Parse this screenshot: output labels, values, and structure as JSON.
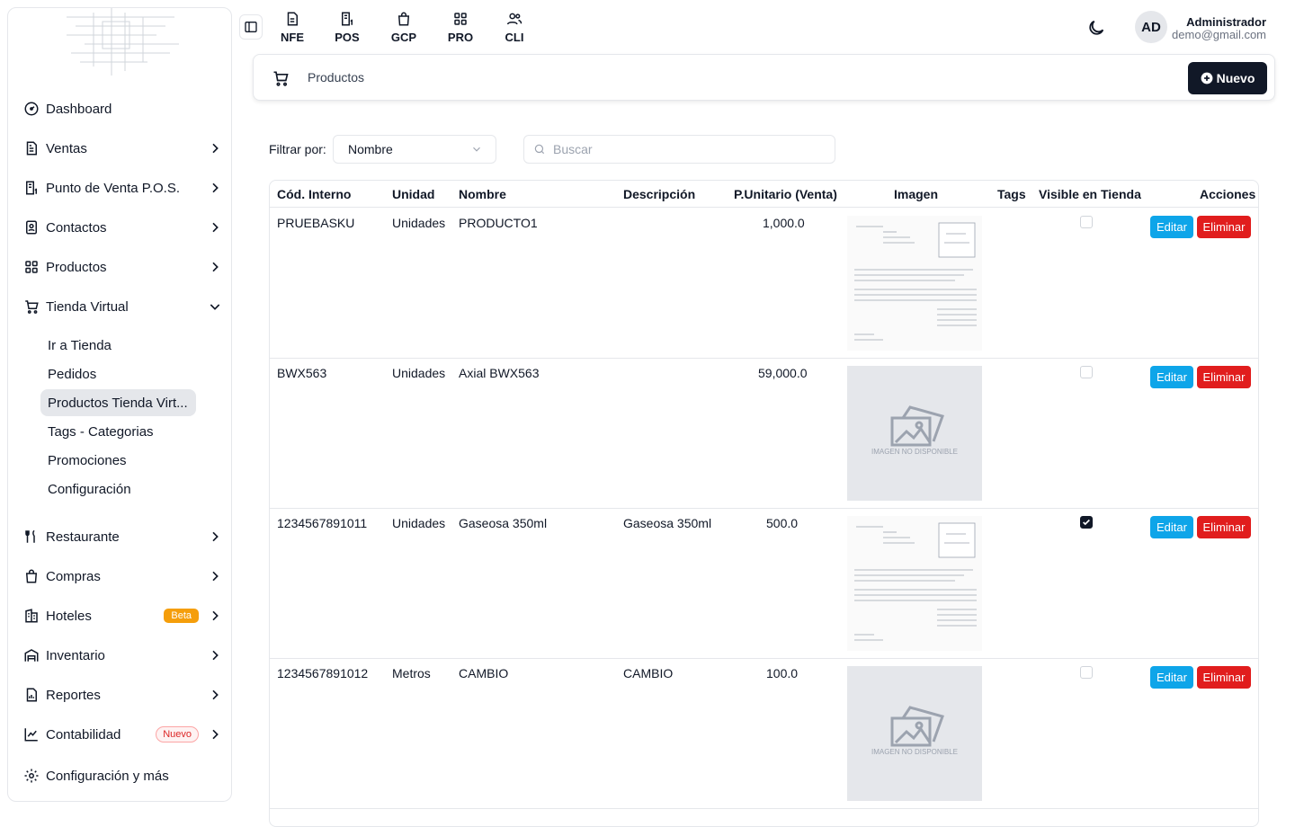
{
  "sidebar": {
    "items": [
      {
        "label": "Dashboard"
      },
      {
        "label": "Ventas"
      },
      {
        "label": "Punto de Venta P.O.S."
      },
      {
        "label": "Contactos"
      },
      {
        "label": "Productos"
      },
      {
        "label": "Tienda Virtual"
      },
      {
        "label": "Restaurante"
      },
      {
        "label": "Compras"
      },
      {
        "label": "Hoteles",
        "badge": "Beta"
      },
      {
        "label": "Inventario"
      },
      {
        "label": "Reportes"
      },
      {
        "label": "Contabilidad",
        "badge": "Nuevo"
      },
      {
        "label": "Configuración y más"
      }
    ],
    "sub_items": [
      {
        "label": "Ir a Tienda"
      },
      {
        "label": "Pedidos"
      },
      {
        "label": "Productos Tienda Virt..."
      },
      {
        "label": "Tags - Categorias"
      },
      {
        "label": "Promociones"
      },
      {
        "label": "Configuración"
      }
    ]
  },
  "topbar": {
    "quick_links": [
      "NFE",
      "POS",
      "GCP",
      "PRO",
      "CLI"
    ],
    "avatar_initials": "AD",
    "user_name": "Administrador",
    "user_email": "demo@gmail.com"
  },
  "header": {
    "title": "Productos",
    "new_button": "Nuevo"
  },
  "filter": {
    "label": "Filtrar por:",
    "selected": "Nombre",
    "search_placeholder": "Buscar"
  },
  "table": {
    "columns": [
      "Cód. Interno",
      "Unidad",
      "Nombre",
      "Descripción",
      "P.Unitario (Venta)",
      "Imagen",
      "Tags",
      "Visible en Tienda",
      "Acciones"
    ],
    "rows": [
      {
        "code": "PRUEBASKU",
        "unit": "Unidades",
        "name": "PRODUCTO1",
        "description": "",
        "price": "1,000.0",
        "image": "receipt",
        "visible": false
      },
      {
        "code": "BWX563",
        "unit": "Unidades",
        "name": "Axial BWX563",
        "description": "",
        "price": "59,000.0",
        "image": "placeholder",
        "visible": false
      },
      {
        "code": "1234567891011",
        "unit": "Unidades",
        "name": "Gaseosa 350ml",
        "description": "Gaseosa 350ml",
        "price": "500.0",
        "image": "receipt",
        "visible": true
      },
      {
        "code": "1234567891012",
        "unit": "Metros",
        "name": "CAMBIO",
        "description": "CAMBIO",
        "price": "100.0",
        "image": "placeholder",
        "visible": false
      }
    ],
    "edit_label": "Editar",
    "delete_label": "Eliminar",
    "image_placeholder_text": "IMAGEN NO DISPONIBLE"
  },
  "colors": {
    "primary_dark": "#111827",
    "edit_button": "#0ea5e9",
    "delete_button": "#e11d1d",
    "beta_badge": "#f59e0b",
    "nuevo_badge": "#dc2626"
  }
}
